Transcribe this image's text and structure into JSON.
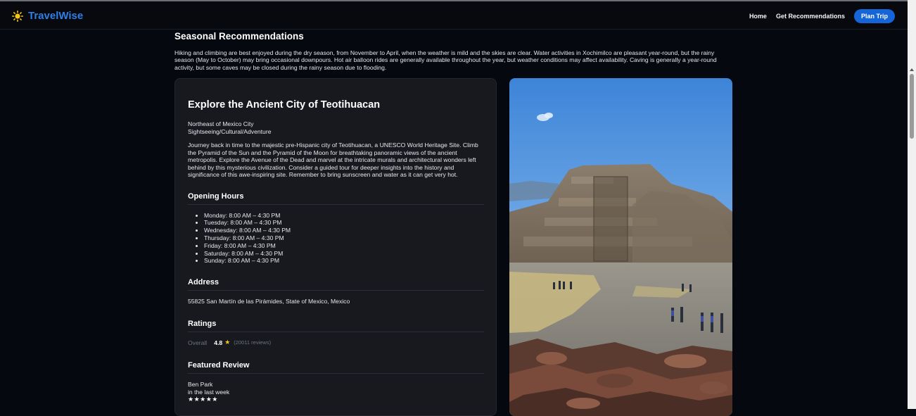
{
  "header": {
    "brand": "TravelWise",
    "nav": {
      "home": "Home",
      "recommendations": "Get Recommendations",
      "plan_trip": "Plan Trip"
    }
  },
  "seasonal": {
    "title": "Seasonal Recommendations",
    "text": "Hiking and climbing are best enjoyed during the dry season, from November to April, when the weather is mild and the skies are clear. Water activities in Xochimilco are pleasant year-round, but the rainy season (May to October) may bring occasional downpours. Hot air balloon rides are generally available throughout the year, but weather conditions may affect availability. Caving is generally a year-round activity, but some caves may be closed during the rainy season due to flooding."
  },
  "attraction": {
    "title": "Explore the Ancient City of Teotihuacan",
    "location": "Northeast of Mexico City",
    "categories": "Sightseeing/Cultural/Adventure",
    "description": "Journey back in time to the majestic pre-Hispanic city of Teotihuacan, a UNESCO World Heritage Site. Climb the Pyramid of the Sun and the Pyramid of the Moon for breathtaking panoramic views of the ancient metropolis. Explore the Avenue of the Dead and marvel at the intricate murals and architectural wonders left behind by this mysterious civilization. Consider a guided tour for deeper insights into the history and significance of this awe-inspiring site. Remember to bring sunscreen and water as it can get very hot.",
    "hours_title": "Opening Hours",
    "hours": [
      "Monday: 8:00 AM – 4:30 PM",
      "Tuesday: 8:00 AM – 4:30 PM",
      "Wednesday: 8:00 AM – 4:30 PM",
      "Thursday: 8:00 AM – 4:30 PM",
      "Friday: 8:00 AM – 4:30 PM",
      "Saturday: 8:00 AM – 4:30 PM",
      "Sunday: 8:00 AM – 4:30 PM"
    ],
    "address_title": "Address",
    "address": "55825 San Martín de las Pirámides, State of Mexico, Mexico",
    "ratings_title": "Ratings",
    "rating_label": "Overall",
    "rating_value": "4.8",
    "rating_star": "★",
    "rating_count": "(20011 reviews)",
    "review_title": "Featured Review",
    "reviewer": "Ben Park",
    "review_time": "in the last week",
    "review_stars": "★★★★★"
  },
  "icons": {
    "logo": "sun-icon",
    "star": "star-icon"
  },
  "colors": {
    "brand": "#2f7fe8",
    "button": "#1565d8",
    "star": "#f5c518",
    "background": "#06080f",
    "card": "#17191f"
  }
}
